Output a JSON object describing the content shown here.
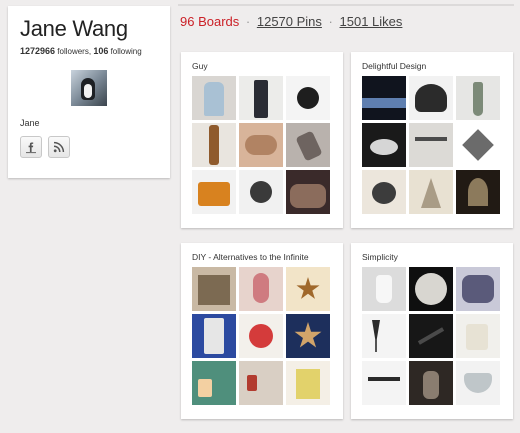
{
  "profile": {
    "name": "Jane Wang",
    "followers_count": "1272966",
    "followers_label": "followers,",
    "following_count": "106",
    "following_label": "following",
    "first_name": "Jane",
    "social": [
      {
        "icon": "facebook-icon",
        "glyph": "f"
      },
      {
        "icon": "rss-icon",
        "glyph": "rss"
      }
    ]
  },
  "summary": {
    "boards": "96 Boards",
    "sep1": "·",
    "pins": "12570 Pins",
    "sep2": "·",
    "likes": "1501 Likes"
  },
  "boards": [
    {
      "title": "Guy",
      "thumbs": [
        {
          "bg": "#d9d6d2",
          "fg": "#a9c1d4",
          "shape": "shirt"
        },
        {
          "bg": "#ececea",
          "fg": "#2a2c34",
          "shape": "pants"
        },
        {
          "bg": "#f4f4f4",
          "fg": "#1e1e1e",
          "shape": "watch"
        },
        {
          "bg": "#e9e5df",
          "fg": "#8f5a2c",
          "shape": "strap"
        },
        {
          "bg": "#d8b49a",
          "fg": "#b18363",
          "shape": "hands"
        },
        {
          "bg": "#b9b2ad",
          "fg": "#6e6460",
          "shape": "phone"
        },
        {
          "bg": "#f2f2f2",
          "fg": "#d8821f",
          "shape": "bag"
        },
        {
          "bg": "#f1f1f1",
          "fg": "#3a3a3a",
          "shape": "watch"
        },
        {
          "bg": "#3a2a2a",
          "fg": "#8b6c5c",
          "shape": "clutter"
        }
      ]
    },
    {
      "title": "Delightful Design",
      "thumbs": [
        {
          "bg": "#10141e",
          "fg": "#5f7fb0",
          "shape": "night"
        },
        {
          "bg": "#f2f2f2",
          "fg": "#2b2b2b",
          "shape": "pattern"
        },
        {
          "bg": "#e6e6e4",
          "fg": "#7c8a78",
          "shape": "vase"
        },
        {
          "bg": "#1a1a1a",
          "fg": "#d6d6d6",
          "shape": "bird"
        },
        {
          "bg": "#dcdad6",
          "fg": "#4b4b4b",
          "shape": "table"
        },
        {
          "bg": "#ffffff",
          "fg": "#6b6b6b",
          "shape": "pillow"
        },
        {
          "bg": "#ece6dc",
          "fg": "#3c3c3c",
          "shape": "birdtoy"
        },
        {
          "bg": "#e8e1d2",
          "fg": "#a99c86",
          "shape": "paper"
        },
        {
          "bg": "#211a14",
          "fg": "#8c7a5c",
          "shape": "poster"
        }
      ]
    },
    {
      "title": "DIY - Alternatives to the Infinite",
      "thumbs": [
        {
          "bg": "#c9b9a4",
          "fg": "#7c6a52",
          "shape": "shelf"
        },
        {
          "bg": "#e7d3cc",
          "fg": "#cf7b80",
          "shape": "lamp"
        },
        {
          "bg": "#f2e4c8",
          "fg": "#a0682b",
          "shape": "star"
        },
        {
          "bg": "#2c4aa0",
          "fg": "#e6e6e6",
          "shape": "jeans"
        },
        {
          "bg": "#f3f0eb",
          "fg": "#d43b3b",
          "shape": "dots"
        },
        {
          "bg": "#1d2f5c",
          "fg": "#d1a46a",
          "shape": "stars"
        },
        {
          "bg": "#4f8f7c",
          "fg": "#f3d0a2",
          "shape": "mugs"
        },
        {
          "bg": "#d9cfc4",
          "fg": "#b23b2f",
          "shape": "jars"
        },
        {
          "bg": "#f4efe6",
          "fg": "#e2d26b",
          "shape": "book"
        }
      ]
    },
    {
      "title": "Simplicity",
      "thumbs": [
        {
          "bg": "#dcdcdc",
          "fg": "#f7f7f7",
          "shape": "pitcher"
        },
        {
          "bg": "#0f0f0f",
          "fg": "#d8d6d0",
          "shape": "disc"
        },
        {
          "bg": "#c9c9d8",
          "fg": "#5a5a7a",
          "shape": "tray"
        },
        {
          "bg": "#f4f4f4",
          "fg": "#2b2b2b",
          "shape": "glasses"
        },
        {
          "bg": "#171717",
          "fg": "#4a4a4a",
          "shape": "lamp2"
        },
        {
          "bg": "#f1f0ec",
          "fg": "#e7e2d4",
          "shape": "mug"
        },
        {
          "bg": "#f4f4f4",
          "fg": "#2a2a2a",
          "shape": "bench"
        },
        {
          "bg": "#2e2824",
          "fg": "#8a7d70",
          "shape": "vessel"
        },
        {
          "bg": "#f2f2f2",
          "fg": "#bfc6c9",
          "shape": "bowl"
        }
      ]
    }
  ]
}
